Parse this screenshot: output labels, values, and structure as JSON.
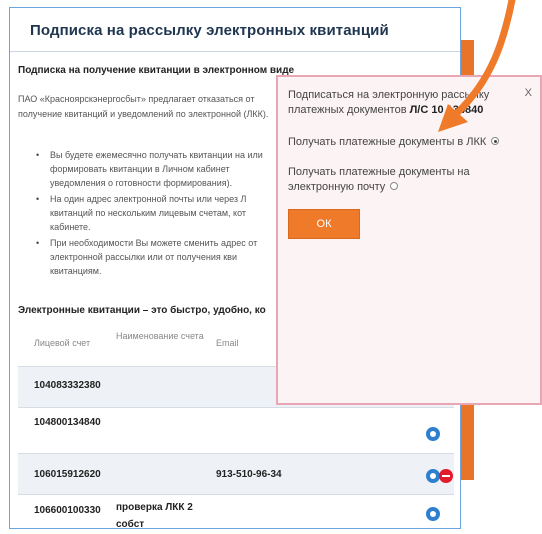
{
  "main": {
    "title": "Подписка на рассылку электронных квитанций",
    "subheading": "Подписка на получение квитанции в электронном виде",
    "intro": "ПАО «Красноярскэнергосбыт» предлагает отказаться от получение квитанций и уведомлений по электронной (ЛКК).",
    "bullets": [
      "Вы будете ежемесячно получать квитанции на или формировать квитанции в Личном кабинет уведомления о готовности формирования).",
      "На один адрес электронной почты или через Л квитанций по нескольким лицевым счетам, кот кабинете.",
      "При необходимости Вы можете сменить адрес от электронной рассылки или от получения кви квитанциям."
    ],
    "tagline": "Электронные квитанции – это быстро, удобно, ко"
  },
  "table": {
    "headers": {
      "account": "Лицевой счет",
      "name": "Наименование счета",
      "email": "Email"
    },
    "rows": [
      {
        "account": "104083332380",
        "name": "",
        "email": ""
      },
      {
        "account": "104800134840",
        "name": "",
        "email": ""
      },
      {
        "account": "106015912620",
        "name": "",
        "email": "913-510-96-34"
      },
      {
        "account": "106600100330",
        "name": "проверка ЛКК 2 собст",
        "email": ""
      }
    ],
    "gear_icon": "gear-icon",
    "minus_icon": "minus-circle-icon"
  },
  "popup": {
    "title_prefix": "Подписаться на электронную рассылку платежных документов ",
    "title_account": "Л/С 10    134840",
    "close": "X",
    "option_lkk": "Получать платежные документы в ЛКК",
    "option_email": "Получать платежные документы на электронную почту",
    "selected": "lkk",
    "ok_label": "ОК"
  },
  "colors": {
    "accent_orange": "#ef7a29",
    "accent_blue": "#2467b0",
    "popup_border": "#e9a6b5"
  }
}
